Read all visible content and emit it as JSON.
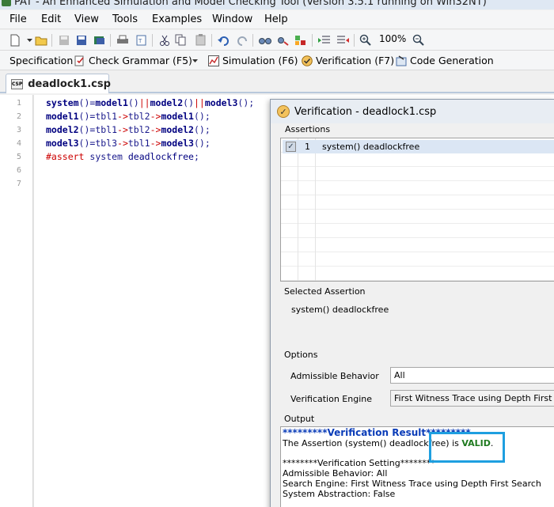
{
  "window": {
    "title": "PAT - An Enhanced Simulation and Model Checking Tool (Version 3.5.1 running on Win32NT)"
  },
  "menu": [
    "File",
    "Edit",
    "View",
    "Tools",
    "Examples",
    "Window",
    "Help"
  ],
  "toolbar": {
    "zoom": "100%"
  },
  "actions": {
    "specification": "Specification",
    "check_grammar": "Check Grammar (F5)",
    "simulation": "Simulation (F6)",
    "verification": "Verification (F7)",
    "code_generation": "Code Generation"
  },
  "tab": {
    "label": "deadlock1.csp",
    "icon_text": "CSP"
  },
  "editor": {
    "line_numbers": [
      "1",
      "2",
      "3",
      "4",
      "5",
      "6",
      "7"
    ]
  },
  "verification": {
    "title": "Verification - deadlock1.csp",
    "assertions_label": "Assertions",
    "assertions": [
      {
        "index": "1",
        "text": "system() deadlockfree"
      }
    ],
    "selected_label": "Selected Assertion",
    "selected_value": "system() deadlockfree",
    "options_label": "Options",
    "admissible_label": "Admissible Behavior",
    "admissible_value": "All",
    "engine_label": "Verification Engine",
    "engine_value": "First Witness Trace using Depth First Search",
    "output_label": "Output",
    "output": {
      "head": "*********Verification Result*********",
      "result_prefix": "The Assertion (system() deadlockfree) is ",
      "result_word": "VALID",
      "result_suffix": ".",
      "setting_head": "********Verification Setting********",
      "admissible": "Admissible Behavior: All",
      "engine": "Search Engine: First Witness Trace using Depth First Search",
      "abstraction": "System Abstraction: False"
    }
  },
  "colors": {
    "valid": "#1f7a1f",
    "result_head": "#0a3cb8",
    "highlight": "#1e9fe0"
  }
}
